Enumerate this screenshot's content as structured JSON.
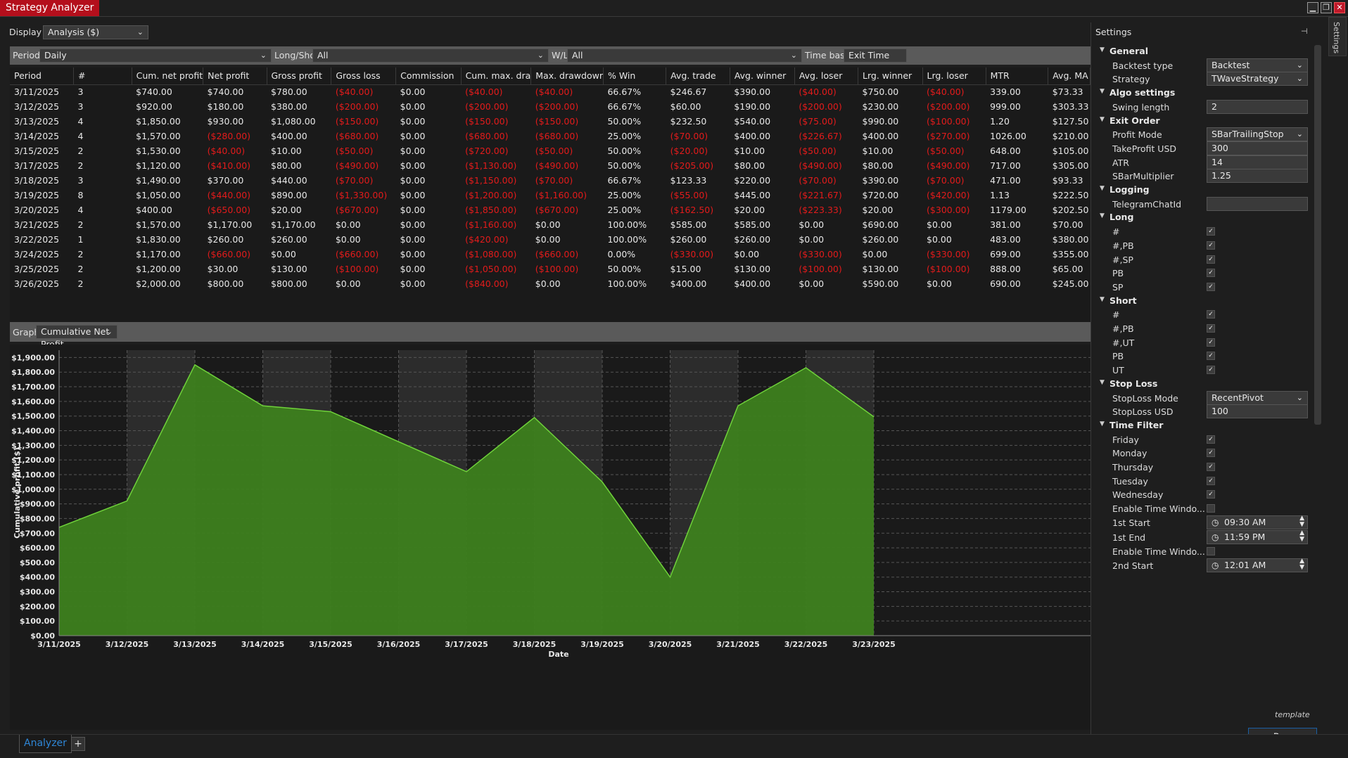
{
  "window": {
    "title": "Strategy Analyzer",
    "sidetab": "Settings"
  },
  "display": {
    "label": "Display",
    "value": "Analysis ($)"
  },
  "filters": {
    "period": {
      "label": "Period",
      "value": "Daily"
    },
    "longshort": {
      "label": "Long/Short",
      "value": "All"
    },
    "wl": {
      "label": "W/L",
      "value": "All"
    },
    "timebase": {
      "label": "Time base",
      "value": "Exit Time"
    }
  },
  "table": {
    "columns": [
      "Period",
      "#",
      "Cum. net profit",
      "Net profit",
      "Gross profit",
      "Gross loss",
      "Commission",
      "Cum. max. dra",
      "Max. drawdowr",
      "% Win",
      "Avg. trade",
      "Avg. winner",
      "Avg. loser",
      "Lrg. winner",
      "Lrg. loser",
      "MTR",
      "Avg. MA"
    ],
    "rows": [
      [
        "3/11/2025",
        "3",
        "$740.00",
        "$740.00",
        "$780.00",
        "($40.00)",
        "$0.00",
        "($40.00)",
        "($40.00)",
        "66.67%",
        "$246.67",
        "$390.00",
        "($40.00)",
        "$750.00",
        "($40.00)",
        "339.00",
        "$73.33"
      ],
      [
        "3/12/2025",
        "3",
        "$920.00",
        "$180.00",
        "$380.00",
        "($200.00)",
        "$0.00",
        "($200.00)",
        "($200.00)",
        "66.67%",
        "$60.00",
        "$190.00",
        "($200.00)",
        "$230.00",
        "($200.00)",
        "999.00",
        "$303.33"
      ],
      [
        "3/13/2025",
        "4",
        "$1,850.00",
        "$930.00",
        "$1,080.00",
        "($150.00)",
        "$0.00",
        "($150.00)",
        "($150.00)",
        "50.00%",
        "$232.50",
        "$540.00",
        "($75.00)",
        "$990.00",
        "($100.00)",
        "1.20",
        "$127.50"
      ],
      [
        "3/14/2025",
        "4",
        "$1,570.00",
        "($280.00)",
        "$400.00",
        "($680.00)",
        "$0.00",
        "($680.00)",
        "($680.00)",
        "25.00%",
        "($70.00)",
        "$400.00",
        "($226.67)",
        "$400.00",
        "($270.00)",
        "1026.00",
        "$210.00"
      ],
      [
        "3/15/2025",
        "2",
        "$1,530.00",
        "($40.00)",
        "$10.00",
        "($50.00)",
        "$0.00",
        "($720.00)",
        "($50.00)",
        "50.00%",
        "($20.00)",
        "$10.00",
        "($50.00)",
        "$10.00",
        "($50.00)",
        "648.00",
        "$105.00"
      ],
      [
        "3/17/2025",
        "2",
        "$1,120.00",
        "($410.00)",
        "$80.00",
        "($490.00)",
        "$0.00",
        "($1,130.00)",
        "($490.00)",
        "50.00%",
        "($205.00)",
        "$80.00",
        "($490.00)",
        "$80.00",
        "($490.00)",
        "717.00",
        "$305.00"
      ],
      [
        "3/18/2025",
        "3",
        "$1,490.00",
        "$370.00",
        "$440.00",
        "($70.00)",
        "$0.00",
        "($1,150.00)",
        "($70.00)",
        "66.67%",
        "$123.33",
        "$220.00",
        "($70.00)",
        "$390.00",
        "($70.00)",
        "471.00",
        "$93.33"
      ],
      [
        "3/19/2025",
        "8",
        "$1,050.00",
        "($440.00)",
        "$890.00",
        "($1,330.00)",
        "$0.00",
        "($1,200.00)",
        "($1,160.00)",
        "25.00%",
        "($55.00)",
        "$445.00",
        "($221.67)",
        "$720.00",
        "($420.00)",
        "1.13",
        "$222.50"
      ],
      [
        "3/20/2025",
        "4",
        "$400.00",
        "($650.00)",
        "$20.00",
        "($670.00)",
        "$0.00",
        "($1,850.00)",
        "($670.00)",
        "25.00%",
        "($162.50)",
        "$20.00",
        "($223.33)",
        "$20.00",
        "($300.00)",
        "1179.00",
        "$202.50"
      ],
      [
        "3/21/2025",
        "2",
        "$1,570.00",
        "$1,170.00",
        "$1,170.00",
        "$0.00",
        "$0.00",
        "($1,160.00)",
        "$0.00",
        "100.00%",
        "$585.00",
        "$585.00",
        "$0.00",
        "$690.00",
        "$0.00",
        "381.00",
        "$70.00"
      ],
      [
        "3/22/2025",
        "1",
        "$1,830.00",
        "$260.00",
        "$260.00",
        "$0.00",
        "$0.00",
        "($420.00)",
        "$0.00",
        "100.00%",
        "$260.00",
        "$260.00",
        "$0.00",
        "$260.00",
        "$0.00",
        "483.00",
        "$380.00"
      ],
      [
        "3/24/2025",
        "2",
        "$1,170.00",
        "($660.00)",
        "$0.00",
        "($660.00)",
        "$0.00",
        "($1,080.00)",
        "($660.00)",
        "0.00%",
        "($330.00)",
        "$0.00",
        "($330.00)",
        "$0.00",
        "($330.00)",
        "699.00",
        "$355.00"
      ],
      [
        "3/25/2025",
        "2",
        "$1,200.00",
        "$30.00",
        "$130.00",
        "($100.00)",
        "$0.00",
        "($1,050.00)",
        "($100.00)",
        "50.00%",
        "$15.00",
        "$130.00",
        "($100.00)",
        "$130.00",
        "($100.00)",
        "888.00",
        "$65.00"
      ],
      [
        "3/26/2025",
        "2",
        "$2,000.00",
        "$800.00",
        "$800.00",
        "$0.00",
        "$0.00",
        "($840.00)",
        "$0.00",
        "100.00%",
        "$400.00",
        "$400.00",
        "$0.00",
        "$590.00",
        "$0.00",
        "690.00",
        "$245.00"
      ]
    ]
  },
  "graph": {
    "label": "Graph",
    "value": "Cumulative Net Profit"
  },
  "chart_data": {
    "type": "area",
    "x": [
      "3/11/2025",
      "3/12/2025",
      "3/13/2025",
      "3/14/2025",
      "3/15/2025",
      "3/16/2025",
      "3/17/2025",
      "3/18/2025",
      "3/19/2025",
      "3/20/2025",
      "3/21/2025",
      "3/22/2025",
      "3/23/2025"
    ],
    "values": [
      740,
      920,
      1850,
      1570,
      1530,
      null,
      1120,
      1490,
      1050,
      400,
      1570,
      1830,
      1495
    ],
    "series": [
      {
        "values": [
          740,
          920,
          1850,
          1570,
          1530,
          1325,
          1120,
          1490,
          1050,
          400,
          1570,
          1830,
          1495
        ]
      }
    ],
    "xlabel": "Date",
    "ylabel": "Cumulative profit ($)",
    "ylim": [
      0,
      1950
    ],
    "yticks": [
      "$0.00",
      "$100.00",
      "$200.00",
      "$300.00",
      "$400.00",
      "$500.00",
      "$600.00",
      "$700.00",
      "$800.00",
      "$900.00",
      "$1,000.00",
      "$1,100.00",
      "$1,200.00",
      "$1,300.00",
      "$1,400.00",
      "$1,500.00",
      "$1,600.00",
      "$1,700.00",
      "$1,800.00",
      "$1,900.00"
    ],
    "grid": true,
    "colors": {
      "fill": "#3d7f1e",
      "line": "#6fd23a"
    }
  },
  "settings": {
    "title": "Settings",
    "rows": [
      {
        "type": "cat",
        "label": "General"
      },
      {
        "type": "select",
        "label": "Backtest type",
        "value": "Backtest"
      },
      {
        "type": "select",
        "label": "Strategy",
        "value": "TWaveStrategy"
      },
      {
        "type": "cat",
        "label": "Algo settings"
      },
      {
        "type": "text",
        "label": "Swing length",
        "value": "2"
      },
      {
        "type": "cat",
        "label": "Exit Order"
      },
      {
        "type": "select",
        "label": "Profit Mode",
        "value": "SBarTrailingStop"
      },
      {
        "type": "text",
        "label": "TakeProfit USD",
        "value": "300"
      },
      {
        "type": "text",
        "label": "ATR",
        "value": "14"
      },
      {
        "type": "text",
        "label": "SBarMultiplier",
        "value": "1.25"
      },
      {
        "type": "cat",
        "label": "Logging"
      },
      {
        "type": "text",
        "label": "TelegramChatId",
        "value": ""
      },
      {
        "type": "cat",
        "label": "Long"
      },
      {
        "type": "check",
        "label": "#",
        "value": true
      },
      {
        "type": "check",
        "label": "#,PB",
        "value": true
      },
      {
        "type": "check",
        "label": "#,SP",
        "value": true
      },
      {
        "type": "check",
        "label": "PB",
        "value": true
      },
      {
        "type": "check",
        "label": "SP",
        "value": true
      },
      {
        "type": "cat",
        "label": "Short"
      },
      {
        "type": "check",
        "label": "#",
        "value": true
      },
      {
        "type": "check",
        "label": "#,PB",
        "value": true
      },
      {
        "type": "check",
        "label": "#,UT",
        "value": true
      },
      {
        "type": "check",
        "label": "PB",
        "value": true
      },
      {
        "type": "check",
        "label": "UT",
        "value": true
      },
      {
        "type": "cat",
        "label": "Stop Loss"
      },
      {
        "type": "select",
        "label": "StopLoss Mode",
        "value": "RecentPivot"
      },
      {
        "type": "text",
        "label": "StopLoss USD",
        "value": "100"
      },
      {
        "type": "cat",
        "label": "Time Filter"
      },
      {
        "type": "check",
        "label": "Friday",
        "value": true
      },
      {
        "type": "check",
        "label": "Monday",
        "value": true
      },
      {
        "type": "check",
        "label": "Thursday",
        "value": true
      },
      {
        "type": "check",
        "label": "Tuesday",
        "value": true
      },
      {
        "type": "check",
        "label": "Wednesday",
        "value": true
      },
      {
        "type": "check",
        "label": "Enable Time Windo...",
        "value": false
      },
      {
        "type": "time",
        "label": "1st Start",
        "value": "09:30 AM"
      },
      {
        "type": "time",
        "label": "1st End",
        "value": "11:59 PM"
      },
      {
        "type": "check",
        "label": "Enable Time Windo...",
        "value": false
      },
      {
        "type": "time",
        "label": "2nd Start",
        "value": "12:01 AM"
      }
    ],
    "template_label": "template",
    "run_label": "Run"
  },
  "tabs": {
    "analyzer": "Analyzer",
    "add": "+"
  }
}
